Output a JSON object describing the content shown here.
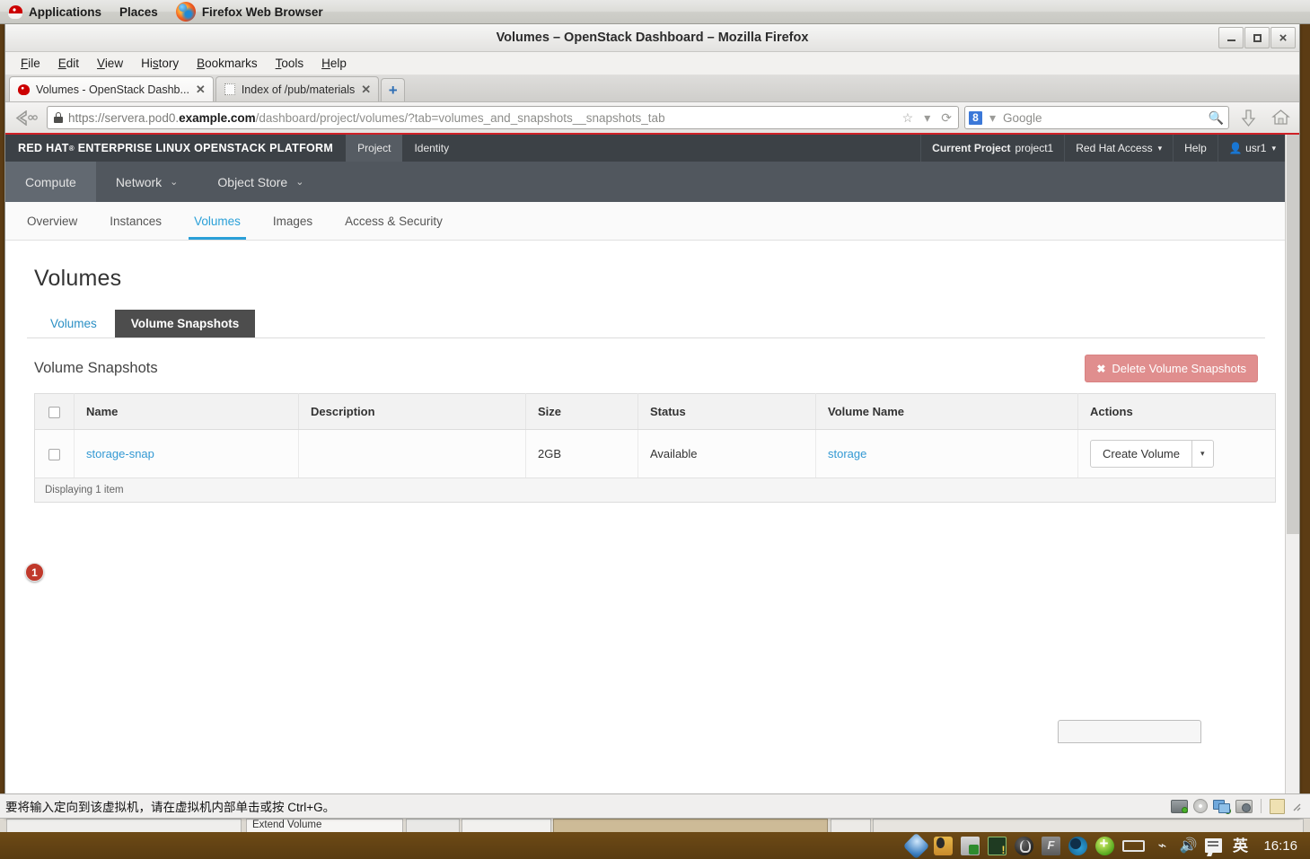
{
  "desktop": {
    "panel": {
      "applications": "Applications",
      "places": "Places",
      "active_app": "Firefox Web Browser"
    },
    "taskbar": {
      "clock": "16:16",
      "tray_icons": [
        "bluetooth-icon",
        "qq-penguin-icon",
        "file-share-icon",
        "terminal-alert-icon",
        "sogou-icon",
        "font-manager-icon",
        "browser-icon",
        "update-icon",
        "battery-icon",
        "wifi-icon",
        "volume-icon",
        "ime-panel-icon",
        "ime-chinese-icon"
      ],
      "ime_label": "英"
    },
    "background_windows": {
      "partial_title": "Extend Volume"
    }
  },
  "browser": {
    "window_title": "Volumes – OpenStack Dashboard – Mozilla Firefox",
    "window_buttons": {
      "minimize": "minimize-button",
      "maximize": "maximize-button",
      "close": "close-button"
    },
    "menus": [
      {
        "label": "File",
        "accel": "F"
      },
      {
        "label": "Edit",
        "accel": "E"
      },
      {
        "label": "View",
        "accel": "V"
      },
      {
        "label": "History",
        "accel": "s"
      },
      {
        "label": "Bookmarks",
        "accel": "B"
      },
      {
        "label": "Tools",
        "accel": "T"
      },
      {
        "label": "Help",
        "accel": "H"
      }
    ],
    "tabs": [
      {
        "title": "Volumes - OpenStack Dashb...",
        "active": true,
        "favicon": "redhat-favicon"
      },
      {
        "title": "Index of /pub/materials",
        "active": false,
        "favicon": "generic-page-favicon"
      }
    ],
    "new_tab_label": "+",
    "urlbar": {
      "scheme": "https://",
      "host_prefix": "servera.pod0.",
      "host_bold": "example.com",
      "path": "/dashboard/project/volumes/?tab=volumes_and_snapshots__snapshots_tab",
      "lock": "secure-lock-icon"
    },
    "searchbar": {
      "engine": "Google",
      "engine_badge": "8",
      "placeholder": "Google"
    },
    "toolbar_icons": [
      "back-button",
      "bookmark-star-icon",
      "reload-icon",
      "search-icon",
      "downloads-icon",
      "home-icon"
    ]
  },
  "dashboard": {
    "brand": "RED HAT® ENTERPRISE LINUX OPENSTACK PLATFORM",
    "brand_parts": {
      "redhat": "RED HAT",
      "sup": "®",
      "rest": "ENTERPRISE LINUX OPENSTACK PLATFORM"
    },
    "top_nav": [
      {
        "label": "Project",
        "selected": true
      },
      {
        "label": "Identity",
        "selected": false
      }
    ],
    "top_right": {
      "current_project_label": "Current Project",
      "current_project_value": "project1",
      "red_hat_access": "Red Hat Access",
      "help": "Help",
      "user": "usr1"
    },
    "sub_nav": [
      {
        "label": "Compute",
        "selected": true,
        "has_caret": false
      },
      {
        "label": "Network",
        "selected": false,
        "has_caret": true
      },
      {
        "label": "Object Store",
        "selected": false,
        "has_caret": true
      }
    ],
    "crumbs": [
      {
        "label": "Overview",
        "selected": false
      },
      {
        "label": "Instances",
        "selected": false
      },
      {
        "label": "Volumes",
        "selected": true
      },
      {
        "label": "Images",
        "selected": false
      },
      {
        "label": "Access & Security",
        "selected": false
      }
    ],
    "page_title": "Volumes",
    "subtabs": [
      {
        "label": "Volumes",
        "active": false
      },
      {
        "label": "Volume Snapshots",
        "active": true
      }
    ],
    "panel": {
      "title": "Volume Snapshots",
      "delete_button": "Delete Volume Snapshots",
      "delete_icon": "✖"
    },
    "table": {
      "columns": [
        "",
        "Name",
        "Description",
        "Size",
        "Status",
        "Volume Name",
        "Actions"
      ],
      "rows": [
        {
          "name": "storage-snap",
          "description": "",
          "size": "2GB",
          "status": "Available",
          "volume_name": "storage",
          "action_button": "Create Volume",
          "action_caret": "▾"
        }
      ],
      "footer": "Displaying 1 item"
    },
    "annotation_badge": "1"
  },
  "vm_status": {
    "message": "要将输入定向到该虚拟机，请在虚拟机内部单击或按 Ctrl+G。",
    "icons": [
      "hard-disk-icon",
      "cdrom-icon",
      "network-icon",
      "camera-icon",
      "notes-icon"
    ]
  },
  "colors": {
    "redhat_red": "#cf2026",
    "header_dark": "#3c4146",
    "subnav": "#51575e",
    "link_blue": "#3399d3",
    "accent_blue": "#2aa0d8",
    "danger": "#e08e8e",
    "badge_red": "#c0392b",
    "desktop_brown": "#5c3c14"
  }
}
